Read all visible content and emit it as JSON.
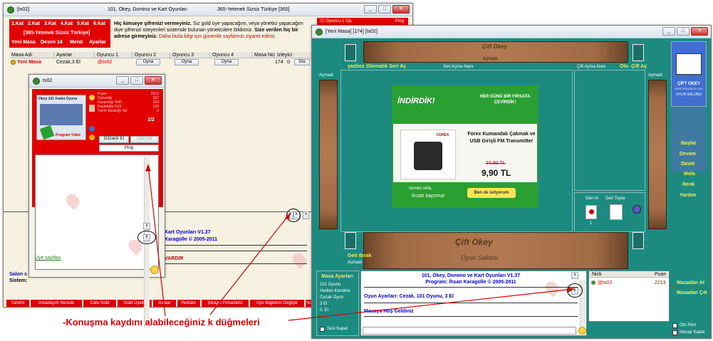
{
  "main_window": {
    "title": "[tx02]",
    "title_mid": "101, Okey, Domino ve Kart Oyunları",
    "title_right": "365-Yetenek Sizsiz Türkiye   [365]",
    "floors": [
      "1.Kat",
      "2.Kat",
      "3.Kat",
      "4.Kat",
      "5.Kat",
      "6.Kat"
    ],
    "floor_banner": "[365-Yetenek Sizsiz Türkiye]",
    "menu": [
      "Yeni Masa",
      "Desen 14",
      "Menü",
      "Ayarlar"
    ],
    "online": "22 Oyuncu-1 Op.",
    "ping": "Ping",
    "notice_bold1": "Hiç kimseye şifrenizi vermeyiniz.",
    "notice_text1": " Siz gold üye yapacağım, veya yönetici yapacağım diye şifrenizi isteyenleri sistemde bulunan yöneticilere bildiriniz.",
    "notice_bold2": " Size verilen hiç bir adrese girmeyiniz.",
    "notice_red": " Daha fazla bilgi için güvenlik sayfamızı ziyaret ediniz.",
    "columns": [
      "Masa Adı",
      "Ayarlar",
      "Oyuncu 1",
      "Oyuncu 2",
      "Oyuncu 3",
      "Oyuncu 4",
      "Masa No",
      "İzleyici"
    ],
    "row": {
      "name": "Yeni Masa",
      "settings": "Cezak,3 El",
      "player1": "@tx02",
      "play": "Oyna",
      "table_no": "174",
      "watchers": "0",
      "watch": "İzle"
    },
    "chat_title": "Kart Oyunları V1.37",
    "chat_program": "Karagülle © 2005-2011",
    "chat_red": "VARDIR",
    "salon": "Salon s",
    "sistem": "Sistem:",
    "k_btns": [
      "x",
      "k",
      "x"
    ],
    "footer": [
      "Yardım",
      "Arkadaşım Nerede",
      "Cafe Gold",
      "Gold Üyelik",
      "Avatar",
      "Reklam",
      "Şikayet Prosedürü",
      "Üye Bilgilerini Değiştir",
      "No"
    ]
  },
  "profile_window": {
    "title": "tx02",
    "game_title": "Okey 101 Kadet Oyunu",
    "program_label": "Program Yükle",
    "stats_labels": [
      "Puanı",
      "Oynadığı",
      "Kazandığı %40",
      "Kaybettiği %25",
      "Yarım Bıraktığı %0"
    ],
    "stats_values": [
      "2213",
      "507",
      "204",
      "130",
      "0"
    ],
    "stat_fraction": "1/2",
    "buttons": [
      "Gözardı Et",
      "Dan Ver"
    ],
    "ping": "Ping",
    "link": "Üye sayfası",
    "k_btns": [
      "x",
      "k"
    ]
  },
  "game_window": {
    "title": "[Yeni Masa] [174] [tx02]",
    "top_labels": {
      "yazboz": "yazboz",
      "auto": "Otomatik Seri Aç",
      "seri": "Seri Açma Alanı",
      "cift": "Çift Açma Alanı",
      "oto_cift": "Oto. Çift Aç",
      "acmadi": "Açmadı"
    },
    "rack_brand": "Çift Okey",
    "rack_brand2": "Oyun Salonu",
    "ad": {
      "brand": "İNDİRDİK!",
      "tag": "HER GÜNÜ BİR FIRSATA ÇEVİRDİK!",
      "forex": "FOREX",
      "product": "Forex Kumandalı Çakmak ve USB Girişli FM Transmitter",
      "old_price": "24,90 TL",
      "price": "9,90 TL",
      "cta1": "hemen tıkla,",
      "cta2": "fırsatı kaçırma!",
      "cta_button": "Ben de istiyorum"
    },
    "right_menu": [
      "Başlat",
      "Devam",
      "Davet",
      "Mola",
      "Renk",
      "Yardım",
      "Masadan At",
      "Masadan Çık"
    ],
    "sidebar_logo": "ÇİFT OKEY",
    "sidebar_logo2": "OYUN SALONU",
    "sidebar_url": "www.okeyoyun.com",
    "geri_al": "Geri Al",
    "geri_topla": "Geri Topla",
    "geri_al_count": "1",
    "geri_birak": "Geri Bırak",
    "table_settings": {
      "title": "Masa Ayarları",
      "lines": [
        "101 Oyunu",
        "Herkes Kendine",
        "Cezak Oyun",
        "3 El",
        "0. El"
      ]
    },
    "sesi_kapat": "Sesi Kapat",
    "chat": {
      "line1": "101, Okey, Domino ve Kart Oyunları V1.37",
      "line2": "Program: İhsan Karagülle © 2005-2011",
      "settings": "Oyun Ayarları: Cezak, 101 Oyunu, 3 El",
      "welcome": "Masaya Hoş Geldiniz",
      "k_btns": [
        "x",
        "k"
      ]
    },
    "nick_header": "Nick",
    "puan_header": "Puan",
    "player": {
      "nick": "@tx02",
      "puan": "2213"
    },
    "oto_pilot": "Oto Pilot",
    "mesaj_kapat": "Mesajı Kapat"
  },
  "annotation": "-Konuşma kaydını alabileceğiniz k düğmeleri",
  "colors": {
    "red": "#e20000",
    "teal": "#1d8a80",
    "yellow": "#f2ec5a",
    "annotation": "#d00000",
    "green": "#2aa032"
  }
}
